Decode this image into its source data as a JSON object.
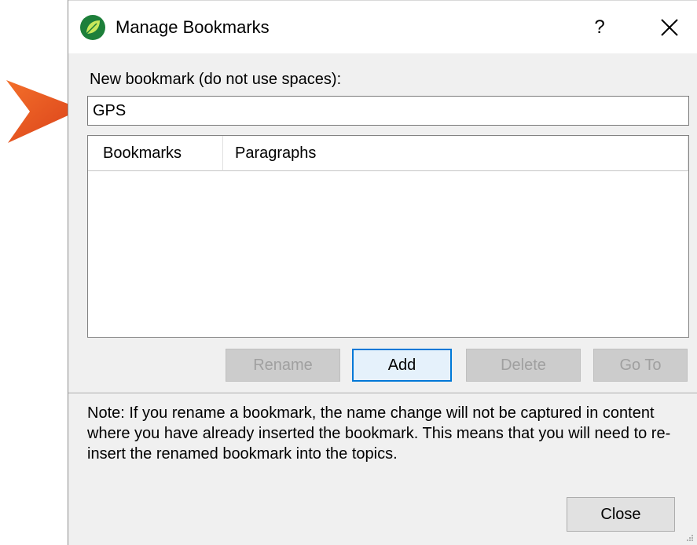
{
  "dialog": {
    "title": "Manage Bookmarks",
    "help_label": "?",
    "icons": {
      "app": "app-leaf-icon",
      "close": "close-icon",
      "pointer": "pointer-arrow-icon"
    },
    "colors": {
      "pointer_arrow": "#e8501e",
      "app_icon": "#1d7f3a",
      "default_button_border": "#0078d7"
    }
  },
  "new_bookmark": {
    "label": "New bookmark (do not use spaces):",
    "value": "GPS"
  },
  "bookmarks_table": {
    "columns": [
      "Bookmarks",
      "Paragraphs"
    ],
    "rows": []
  },
  "buttons": {
    "rename": "Rename",
    "add": "Add",
    "delete": "Delete",
    "goto": "Go To",
    "close": "Close"
  },
  "note": "Note: If you rename a bookmark, the name change will not be captured in content where you have already inserted the bookmark. This means that you will need to re-insert the renamed bookmark into the topics."
}
